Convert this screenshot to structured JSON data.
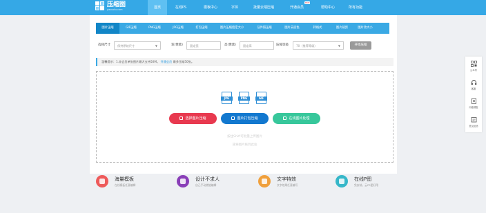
{
  "header": {
    "logo_title": "压缩图",
    "logo_subtitle": "yasuotu.com",
    "nav": [
      {
        "label": "首页"
      },
      {
        "label": "在线PS"
      },
      {
        "label": "模板中心"
      },
      {
        "label": "字体"
      },
      {
        "label": "批量云端压缩"
      },
      {
        "label": "开通会员"
      },
      {
        "label": "帮助中心"
      },
      {
        "label": "所有功能"
      }
    ],
    "hot_badge": "HOT"
  },
  "tabs": [
    {
      "label": "图片压缩"
    },
    {
      "label": "GIF压缩"
    },
    {
      "label": "PNG压缩"
    },
    {
      "label": "JPG压缩"
    },
    {
      "label": "打包压缩"
    },
    {
      "label": "图片压缩指定大小"
    },
    {
      "label": "证件照压缩"
    },
    {
      "label": "图片去底色"
    },
    {
      "label": "转格式"
    },
    {
      "label": "图片裁剪"
    },
    {
      "label": "图片改大小"
    }
  ],
  "options": {
    "size_label": "选择尺寸",
    "size_value": "保持原始尺寸",
    "width_label": "宽(像素)",
    "width_placeholder": "固定宽",
    "height_label": "高(像素)",
    "height_placeholder": "固定高",
    "level_label": "压缩等级",
    "level_value": "70（推荐等级）",
    "start_button": "开始压缩"
  },
  "notice": {
    "text": "温馨提示：1.非会员单张图片最大支持50M。",
    "link": "开通会员",
    "tail": "最多压缩50张。"
  },
  "upload": {
    "filetypes": [
      "JPG",
      "PNG",
      "GIF"
    ],
    "buttons": [
      {
        "label": "选择图片压缩"
      },
      {
        "label": "图片打包压缩"
      },
      {
        "label": "在线图片处理"
      }
    ],
    "hint_line1": "按住Shift可批量上传图片",
    "hint_line2": "或将图片拖到此处"
  },
  "features": [
    {
      "title": "海量模板",
      "desc": "在线模板任意编辑"
    },
    {
      "title": "设计不求人",
      "desc": "自己手动就能编辑"
    },
    {
      "title": "文字特效",
      "desc": "文字效果任意编写"
    },
    {
      "title": "在线P图",
      "desc": "免安装，云PS更好用"
    }
  ],
  "sidebar": [
    {
      "label": "公众号"
    },
    {
      "label": "客服"
    },
    {
      "label": "问卷调查"
    },
    {
      "label": "意见反馈"
    }
  ],
  "colors": {
    "brand": "#35a8e6",
    "tab_active": "#1286c7",
    "button_red": "#e8394f",
    "button_blue": "#1278cf",
    "button_green": "#37c79b"
  }
}
